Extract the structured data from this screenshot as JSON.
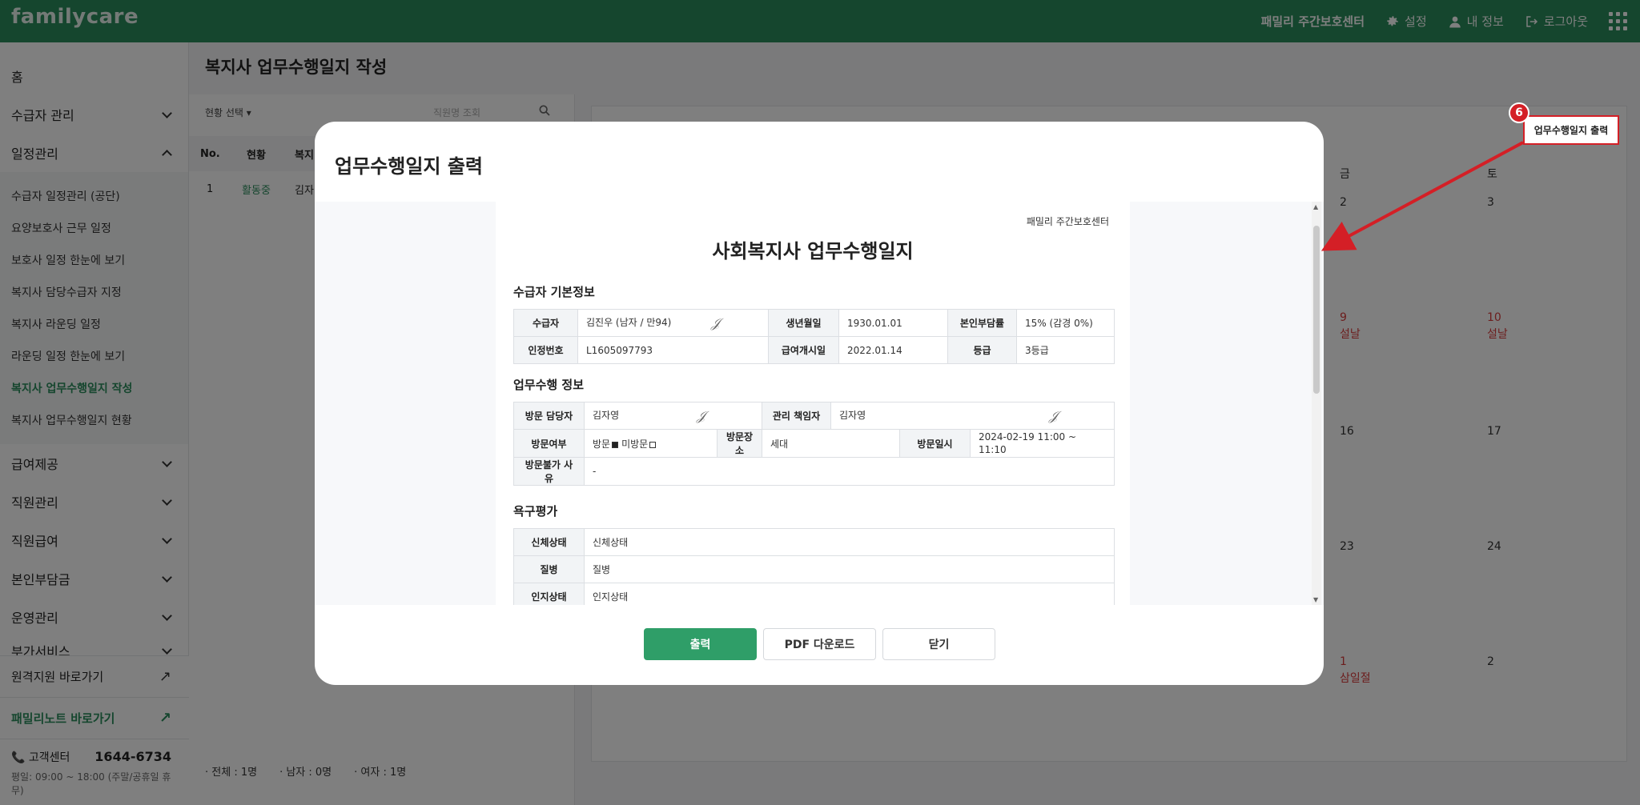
{
  "app": {
    "logo": "familycare",
    "center_name": "패밀리 주간보호센터",
    "settings": "설정",
    "my_info": "내 정보",
    "logout": "로그아웃"
  },
  "sidebar": {
    "home": "홈",
    "groups": [
      {
        "label": "수급자 관리",
        "open": false
      },
      {
        "label": "일정관리",
        "open": true
      }
    ],
    "sub_items": [
      {
        "label": "수급자 일정관리 (공단)",
        "active": false
      },
      {
        "label": "요양보호사 근무 일정",
        "active": false
      },
      {
        "label": "보호사 일정 한눈에 보기",
        "active": false
      },
      {
        "label": "복지사 담당수급자 지정",
        "active": false
      },
      {
        "label": "복지사 라운딩 일정",
        "active": false
      },
      {
        "label": "라운딩 일정 한눈에 보기",
        "active": false
      },
      {
        "label": "복지사 업무수행일지 작성",
        "active": true
      },
      {
        "label": "복지사 업무수행일지 현황",
        "active": false
      }
    ],
    "groups_after": [
      {
        "label": "급여제공"
      },
      {
        "label": "직원관리"
      },
      {
        "label": "직원급여"
      },
      {
        "label": "본인부담금"
      },
      {
        "label": "운영관리"
      },
      {
        "label": "부가서비스"
      }
    ],
    "remote_support": "원격지원 바로가기",
    "family_note": "패밀리노트 바로가기",
    "support_label": "고객센터",
    "support_phone": "1644-6734",
    "support_hours": "평일: 09:00 ~ 18:00 (주말/공휴일 휴무)"
  },
  "main": {
    "page_title": "복지사 업무수행일지 작성",
    "filter_label": "현황 선택",
    "search_placeholder": "직원명 조회",
    "table_headers": [
      "No.",
      "현황",
      "복지"
    ],
    "rows": [
      {
        "no": "1",
        "status": "활동중",
        "name": "김자"
      }
    ],
    "summary": {
      "total": "전체 : 1명",
      "male": "남자 : 0명",
      "female": "여자 : 1명"
    },
    "calendar": {
      "weekday_fri": "금",
      "weekday_sat": "토",
      "days": [
        {
          "label": "2",
          "sub": ""
        },
        {
          "label": "3",
          "sub": ""
        },
        {
          "label": "9",
          "sub": "설날"
        },
        {
          "label": "10",
          "sub": "설날"
        },
        {
          "label": "16",
          "sub": ""
        },
        {
          "label": "17",
          "sub": ""
        },
        {
          "label": "23",
          "sub": ""
        },
        {
          "label": "24",
          "sub": ""
        },
        {
          "label": "1",
          "sub": "삼일절"
        },
        {
          "label": "2",
          "sub": ""
        }
      ]
    }
  },
  "modal": {
    "title": "업무수행일지 출력",
    "doc": {
      "center": "패밀리 주간보호센터",
      "title": "사회복지사 업무수행일지",
      "section_basic": "수급자 기본정보",
      "section_work": "업무수행 정보",
      "section_needs": "욕구평가",
      "basic": {
        "recipient_label": "수급자",
        "recipient_value": "김진우 (남자 / 만94)",
        "birth_label": "생년월일",
        "birth_value": "1930.01.01",
        "copay_label": "본인부담률",
        "copay_value": "15% (감경 0%)",
        "cert_label": "인정번호",
        "cert_value": "L1605097793",
        "start_label": "급여개시일",
        "start_value": "2022.01.14",
        "grade_label": "등급",
        "grade_value": "3등급"
      },
      "work": {
        "visitor_label": "방문 담당자",
        "visitor_value": "김자영",
        "manager_label": "관리 책임자",
        "manager_value": "김자영",
        "visit_label": "방문여부",
        "visit_yes": "방문",
        "visit_no": "미방문",
        "place_label": "방문장소",
        "place_value": "세대",
        "datetime_label": "방문일시",
        "datetime_value": "2024-02-19 11:00 ~ 11:10",
        "reason_label": "방문불가 사유",
        "reason_value": "-"
      },
      "needs": {
        "body_label": "신체상태",
        "body_value": "신체상태",
        "disease_label": "질병",
        "disease_value": "질병",
        "cognitive_label": "인지상태",
        "cognitive_value": "인지상태"
      }
    },
    "buttons": {
      "print": "출력",
      "pdf": "PDF 다운로드",
      "close": "닫기"
    }
  },
  "annotation": {
    "number": "6",
    "label": "업무수행일지 출력",
    "color": "#d41f26"
  },
  "colors": {
    "brand": "#2a8d5c",
    "primary_button": "#2f9e68"
  }
}
